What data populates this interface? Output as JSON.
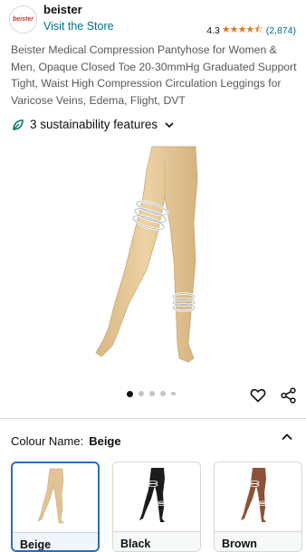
{
  "header": {
    "logo_text": "beister",
    "brand_name": "beister",
    "visit_store": "Visit the Store",
    "rating_value": "4.3",
    "rating_stars": 4.3,
    "rating_count": "(2,874)"
  },
  "product": {
    "title": "Beister Medical Compression Pantyhose for Women & Men, Opaque Closed Toe 20-30mmHg Graduated Support Tight, Waist High Compression Circulation Leggings for Varicose Veins, Edema, Flight, DVT",
    "sustainability": "3 sustainability features",
    "image_count": 5,
    "active_image": 1
  },
  "variation": {
    "label": "Colour Name:",
    "selected": "Beige",
    "options": [
      {
        "label": "Beige",
        "color": "#e2c396"
      },
      {
        "label": "Black",
        "color": "#1c1c1c"
      },
      {
        "label": "Brown",
        "color": "#8a5238"
      }
    ]
  },
  "colors": {
    "link": "#007185",
    "star": "#de7921",
    "leaf": "#067d62",
    "selected_border": "#2a6ebb"
  }
}
